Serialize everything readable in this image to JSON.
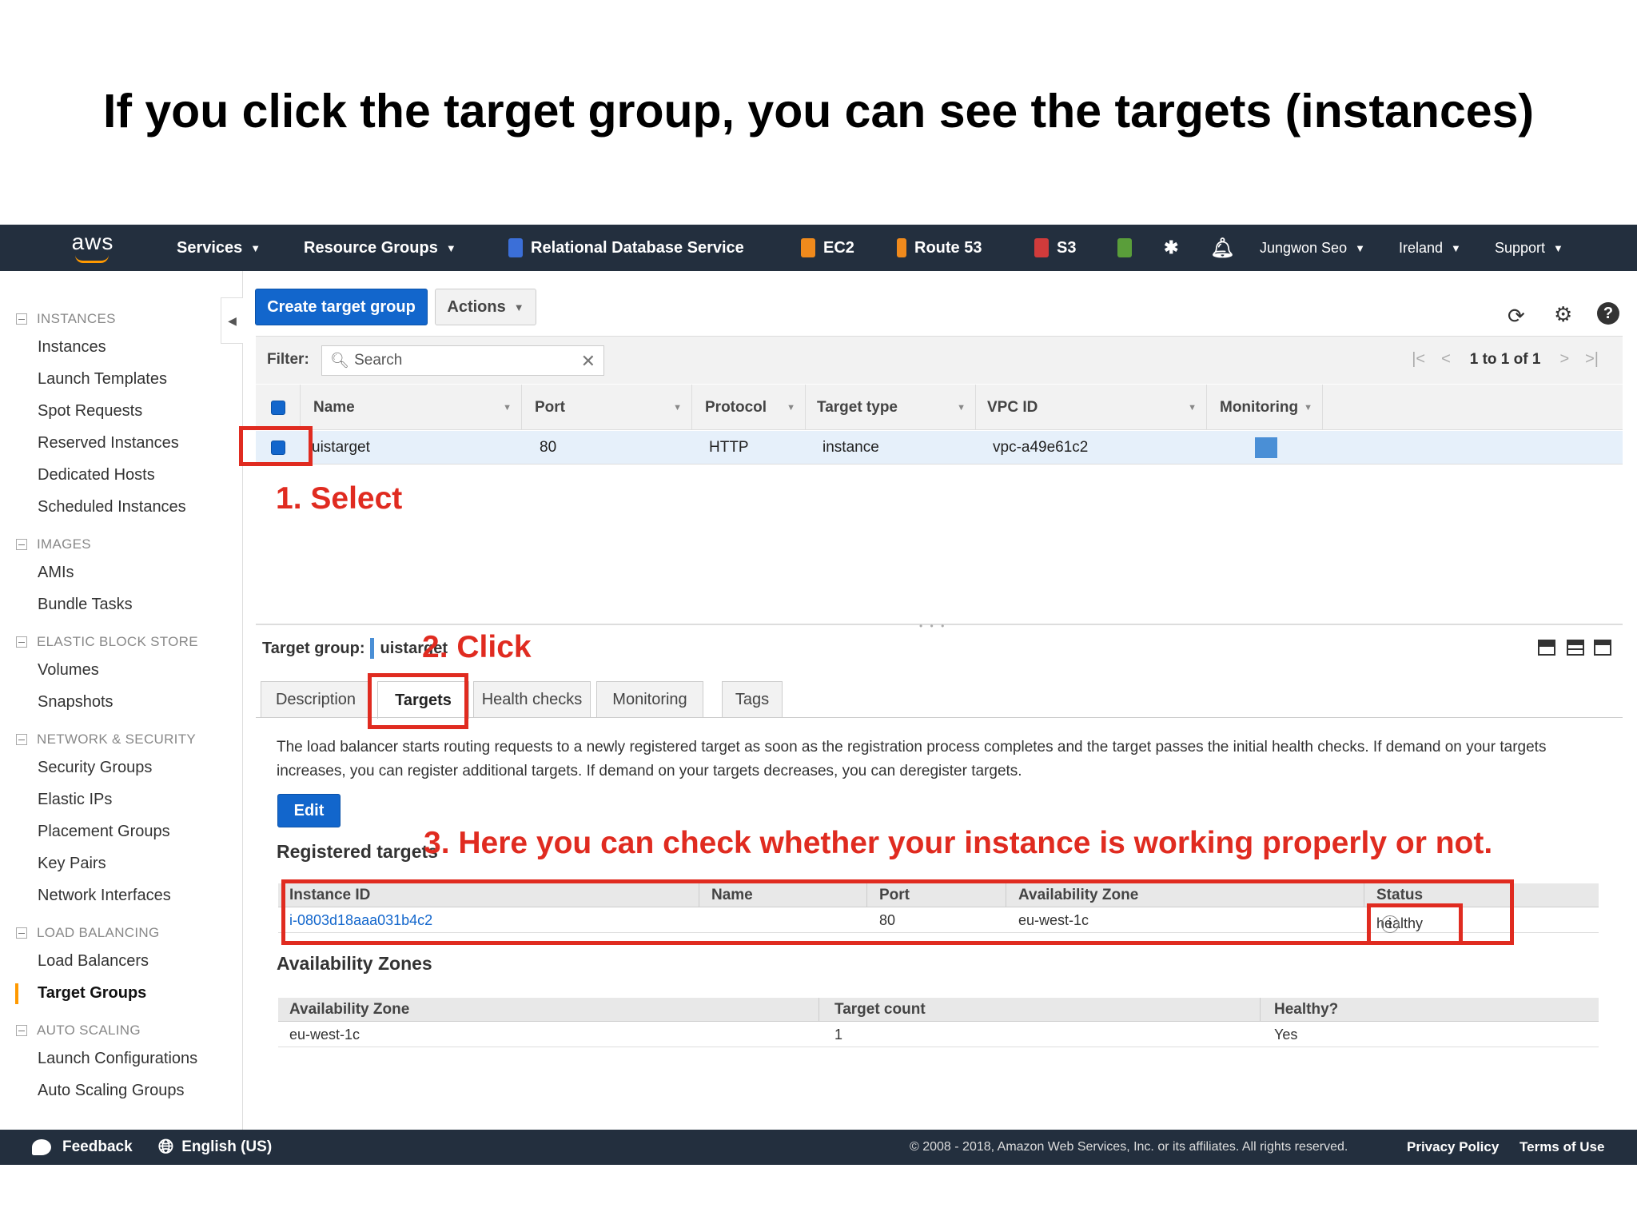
{
  "slide_title": "If you click the target group, you can see the targets (instances)",
  "topnav": {
    "logo": "aws",
    "services": "Services",
    "resource_groups": "Resource Groups",
    "rds": "Relational Database Service",
    "ec2": "EC2",
    "route53": "Route 53",
    "s3": "S3",
    "user": "Jungwon Seo",
    "region": "Ireland",
    "support": "Support"
  },
  "sidebar": {
    "sections": [
      {
        "header": "INSTANCES",
        "items": [
          "Instances",
          "Launch Templates",
          "Spot Requests",
          "Reserved Instances",
          "Dedicated Hosts",
          "Scheduled Instances"
        ]
      },
      {
        "header": "IMAGES",
        "items": [
          "AMIs",
          "Bundle Tasks"
        ]
      },
      {
        "header": "ELASTIC BLOCK STORE",
        "items": [
          "Volumes",
          "Snapshots"
        ]
      },
      {
        "header": "NETWORK & SECURITY",
        "items": [
          "Security Groups",
          "Elastic IPs",
          "Placement Groups",
          "Key Pairs",
          "Network Interfaces"
        ]
      },
      {
        "header": "LOAD BALANCING",
        "items": [
          "Load Balancers",
          "Target Groups"
        ]
      },
      {
        "header": "AUTO SCALING",
        "items": [
          "Launch Configurations",
          "Auto Scaling Groups"
        ]
      }
    ],
    "active_item": "Target Groups"
  },
  "toolbar": {
    "create_label": "Create target group",
    "actions_label": "Actions"
  },
  "filter": {
    "label": "Filter:",
    "placeholder": "Search",
    "pager_text": "1 to 1 of 1"
  },
  "grid": {
    "columns": [
      "Name",
      "Port",
      "Protocol",
      "Target type",
      "VPC ID",
      "Monitoring"
    ],
    "rows": [
      {
        "name": "uistarget",
        "port": "80",
        "protocol": "HTTP",
        "target_type": "instance",
        "vpc_id": "vpc-a49e61c2"
      }
    ]
  },
  "detail": {
    "label": "Target group:",
    "value": "uistarget",
    "tabs": [
      "Description",
      "Targets",
      "Health checks",
      "Monitoring",
      "Tags"
    ],
    "active_tab": "Targets",
    "description": "The load balancer starts routing requests to a newly registered target as soon as the registration process completes and the target passes the initial health checks. If demand on your targets increases, you can register additional targets. If demand on your targets decreases, you can deregister targets.",
    "edit_label": "Edit",
    "registered_title": "Registered targets",
    "registered": {
      "columns": [
        "Instance ID",
        "Name",
        "Port",
        "Availability Zone",
        "Status"
      ],
      "rows": [
        {
          "instance_id": "i-0803d18aaa031b4c2",
          "name": "",
          "port": "80",
          "az": "eu-west-1c",
          "status": "healthy"
        }
      ]
    },
    "az_title": "Availability Zones",
    "az_table": {
      "columns": [
        "Availability Zone",
        "Target count",
        "Healthy?"
      ],
      "rows": [
        {
          "az": "eu-west-1c",
          "count": "1",
          "healthy": "Yes"
        }
      ]
    }
  },
  "footer": {
    "feedback": "Feedback",
    "language": "English (US)",
    "copyright": "© 2008 - 2018, Amazon Web Services, Inc. or its affiliates. All rights reserved.",
    "privacy": "Privacy Policy",
    "terms": "Terms of Use"
  },
  "annotations": {
    "step1": "1. Select",
    "step2": "2. Click",
    "step3": "3. Here you can check whether your instance is working properly or not."
  },
  "colors": {
    "nav_bg": "#232f3e",
    "primary_blue": "#1266cc",
    "annotation_red": "#e02b20",
    "sidebar_active": "#ff9900"
  }
}
